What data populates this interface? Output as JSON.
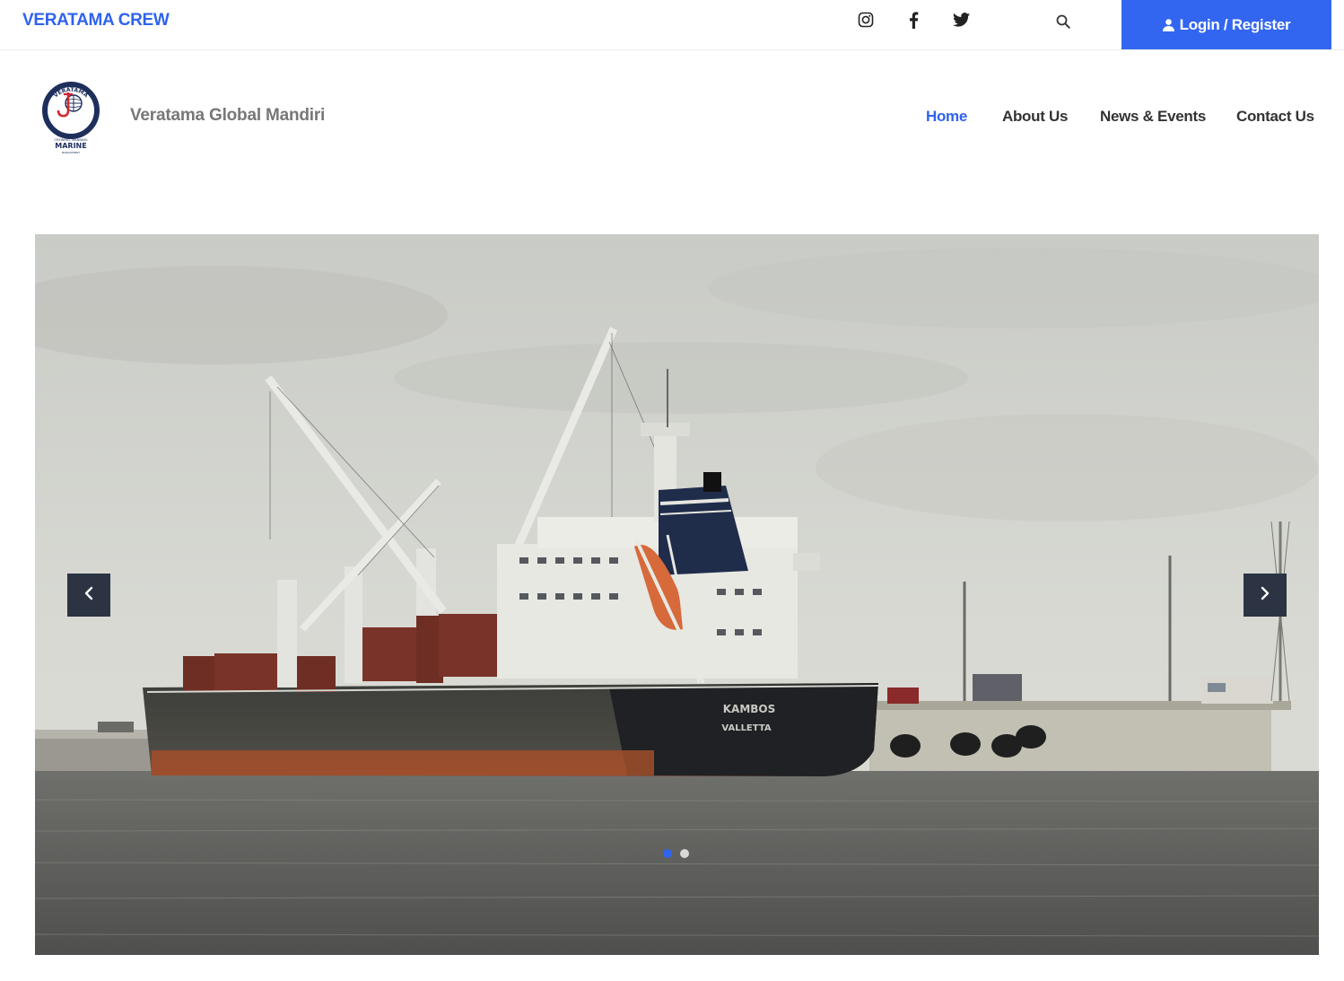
{
  "topbar": {
    "brand": "VERATAMA CREW",
    "social": [
      "instagram-icon",
      "facebook-icon",
      "twitter-icon"
    ],
    "search_icon": "search-icon",
    "login_label": "Login / Register",
    "accent_color": "#3366f0"
  },
  "header": {
    "logo": {
      "arc_text": "VERATAMA",
      "ring_text": "GLOBAL MANDIRI",
      "line1": "CREWING, MANNING",
      "line2": "MARINE",
      "line3": "MANAGEMENT"
    },
    "site_name": "Veratama Global Mandiri",
    "nav": [
      {
        "label": "Home",
        "active": true
      },
      {
        "label": "About Us",
        "active": false
      },
      {
        "label": "News & Events",
        "active": false
      },
      {
        "label": "Contact Us",
        "active": false
      }
    ]
  },
  "slider": {
    "ship_name": "KAMBOS",
    "port": "VALLETTA",
    "prev_icon": "chevron-left-icon",
    "next_icon": "chevron-right-icon",
    "slides_count": 2,
    "active_slide": 1
  }
}
